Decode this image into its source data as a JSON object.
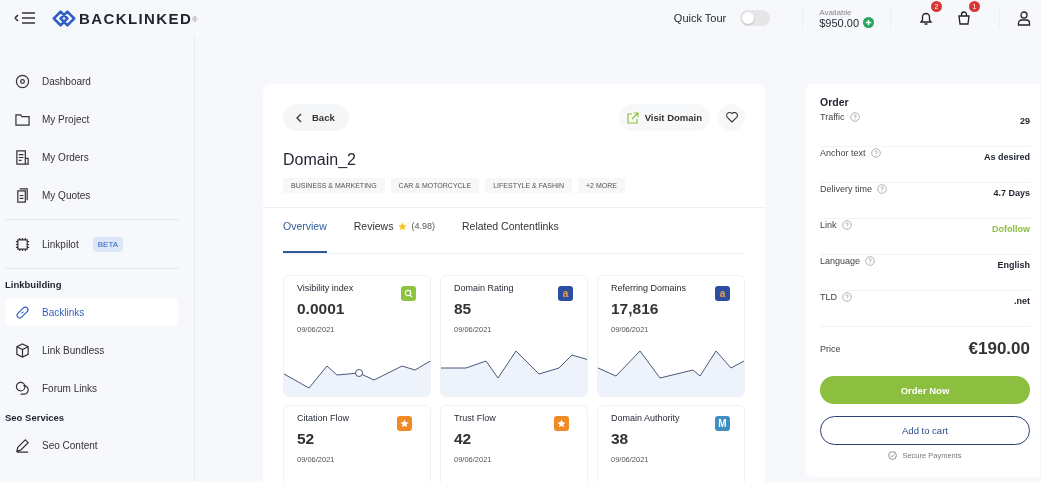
{
  "header": {
    "logo": "BACKLINKED",
    "logo_mark": "®",
    "quick_tour": {
      "label": "Quick Tour",
      "on": false
    },
    "balance": {
      "label": "Available",
      "amount": "$950.00"
    },
    "notifications": "2",
    "cart": "1"
  },
  "sidebar": {
    "items": [
      {
        "kind": "item",
        "label": "Dashboard",
        "selected": false
      },
      {
        "kind": "item",
        "label": "My Project",
        "selected": false
      },
      {
        "kind": "item",
        "label": "My Orders",
        "selected": false
      },
      {
        "kind": "item",
        "label": "My Quotes",
        "selected": false
      },
      {
        "kind": "divider"
      },
      {
        "kind": "item",
        "label": "Linkpilot",
        "badge": "BETA",
        "selected": false
      },
      {
        "kind": "divider"
      },
      {
        "kind": "heading",
        "label": "Linkbuilding"
      },
      {
        "kind": "item",
        "label": "Backlinks",
        "selected": true
      },
      {
        "kind": "item",
        "label": "Link Bundless",
        "selected": false
      },
      {
        "kind": "item",
        "label": "Forum Links",
        "selected": false
      },
      {
        "kind": "heading",
        "label": "Seo Services"
      },
      {
        "kind": "item",
        "label": "Seo Content",
        "selected": false
      }
    ]
  },
  "domain": {
    "back": "Back",
    "visit": "Visit Domain",
    "title": "Domain_2",
    "tags": [
      "BUSINESS & MARKETING",
      "CAR & MOTORCYCLE",
      "LIFESTYLE & FASHIN",
      "+2 MORE"
    ],
    "tabs": [
      {
        "label": "Overview",
        "selected": true
      },
      {
        "label": "Reviews",
        "rating": "(4.98)",
        "selected": false
      },
      {
        "label": "Related Contentlinks",
        "selected": false
      }
    ],
    "metrics": [
      {
        "title": "Visibility index",
        "value": "0.0001",
        "date": "09/06/2021",
        "kind": "search",
        "color": "#8cc43f"
      },
      {
        "title": "Domain Rating",
        "value": "85",
        "date": "09/06/2021",
        "kind": "letter",
        "badge_text": "a",
        "color": "#2c4ea3"
      },
      {
        "title": "Referring Domains",
        "value": "17,816",
        "date": "09/06/2021",
        "kind": "letter",
        "badge_text": "a",
        "color": "#2c4ea3"
      },
      {
        "title": "Citation Flow",
        "value": "52",
        "date": "09/06/2021",
        "kind": "star",
        "color": "#f08a24"
      },
      {
        "title": "Trust Flow",
        "value": "42",
        "date": "09/06/2021",
        "kind": "star",
        "color": "#f08a24"
      },
      {
        "title": "Domain Authority",
        "value": "38",
        "date": "09/06/2021",
        "kind": "letter",
        "badge_text": "M",
        "color": "#3d8fc4"
      }
    ]
  },
  "order": {
    "title": "Order",
    "rows": [
      {
        "label": "Traffic",
        "value": "29",
        "color": "#1f2430"
      },
      {
        "label": "Anchor text",
        "value": "As desired",
        "color": "#1f2430"
      },
      {
        "label": "Delivery time",
        "value": "4.7 Days",
        "color": "#1f2430"
      },
      {
        "label": "Link",
        "value": "Dofollow",
        "color": "#8cbf3f"
      },
      {
        "label": "Language",
        "value": "English",
        "color": "#1f2430"
      },
      {
        "label": "TLD",
        "value": ".net",
        "color": "#1f2430"
      }
    ],
    "price_label": "Price",
    "price": "€190.00",
    "order_button": "Order Now",
    "cart_button": "Add to cart",
    "secure": "Secure Payments"
  }
}
